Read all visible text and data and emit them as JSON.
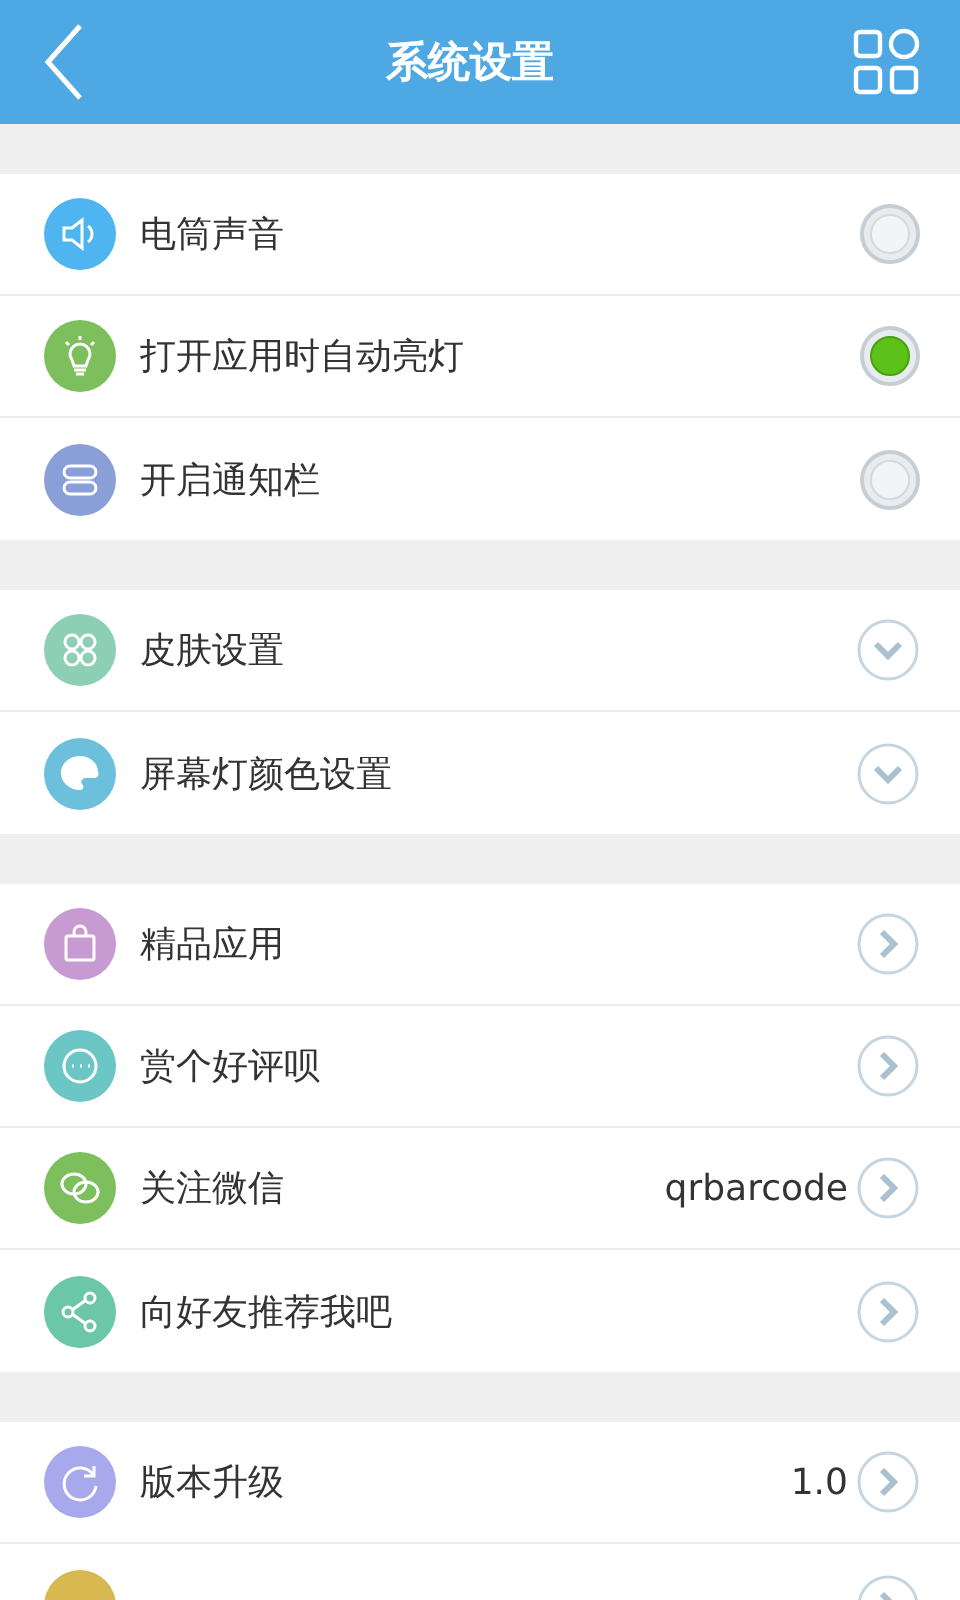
{
  "header": {
    "title": "系统设置"
  },
  "groups": [
    {
      "items": [
        {
          "label": "电筒声音",
          "kind": "toggle",
          "on": false,
          "color": "#4fb5f0"
        },
        {
          "label": "打开应用时自动亮灯",
          "kind": "toggle",
          "on": true,
          "color": "#7cbf5c"
        },
        {
          "label": "开启通知栏",
          "kind": "toggle",
          "on": false,
          "color": "#8a9ed8"
        }
      ]
    },
    {
      "items": [
        {
          "label": "皮肤设置",
          "kind": "expand",
          "color": "#8ccfb4"
        },
        {
          "label": "屏幕灯颜色设置",
          "kind": "expand",
          "color": "#6cc0dc"
        }
      ]
    },
    {
      "items": [
        {
          "label": "精品应用",
          "kind": "link",
          "color": "#c89ad2"
        },
        {
          "label": "赏个好评呗",
          "kind": "link",
          "color": "#6cc6c6"
        },
        {
          "label": "关注微信",
          "kind": "link",
          "value": "qrbarcode",
          "color": "#7cbf5c"
        },
        {
          "label": "向好友推荐我吧",
          "kind": "link",
          "color": "#6cc6a8"
        }
      ]
    },
    {
      "items": [
        {
          "label": "版本升级",
          "kind": "link",
          "value": "1.0",
          "color": "#a8a8ec"
        },
        {
          "kind": "link",
          "color": "#d8b850"
        }
      ]
    }
  ]
}
